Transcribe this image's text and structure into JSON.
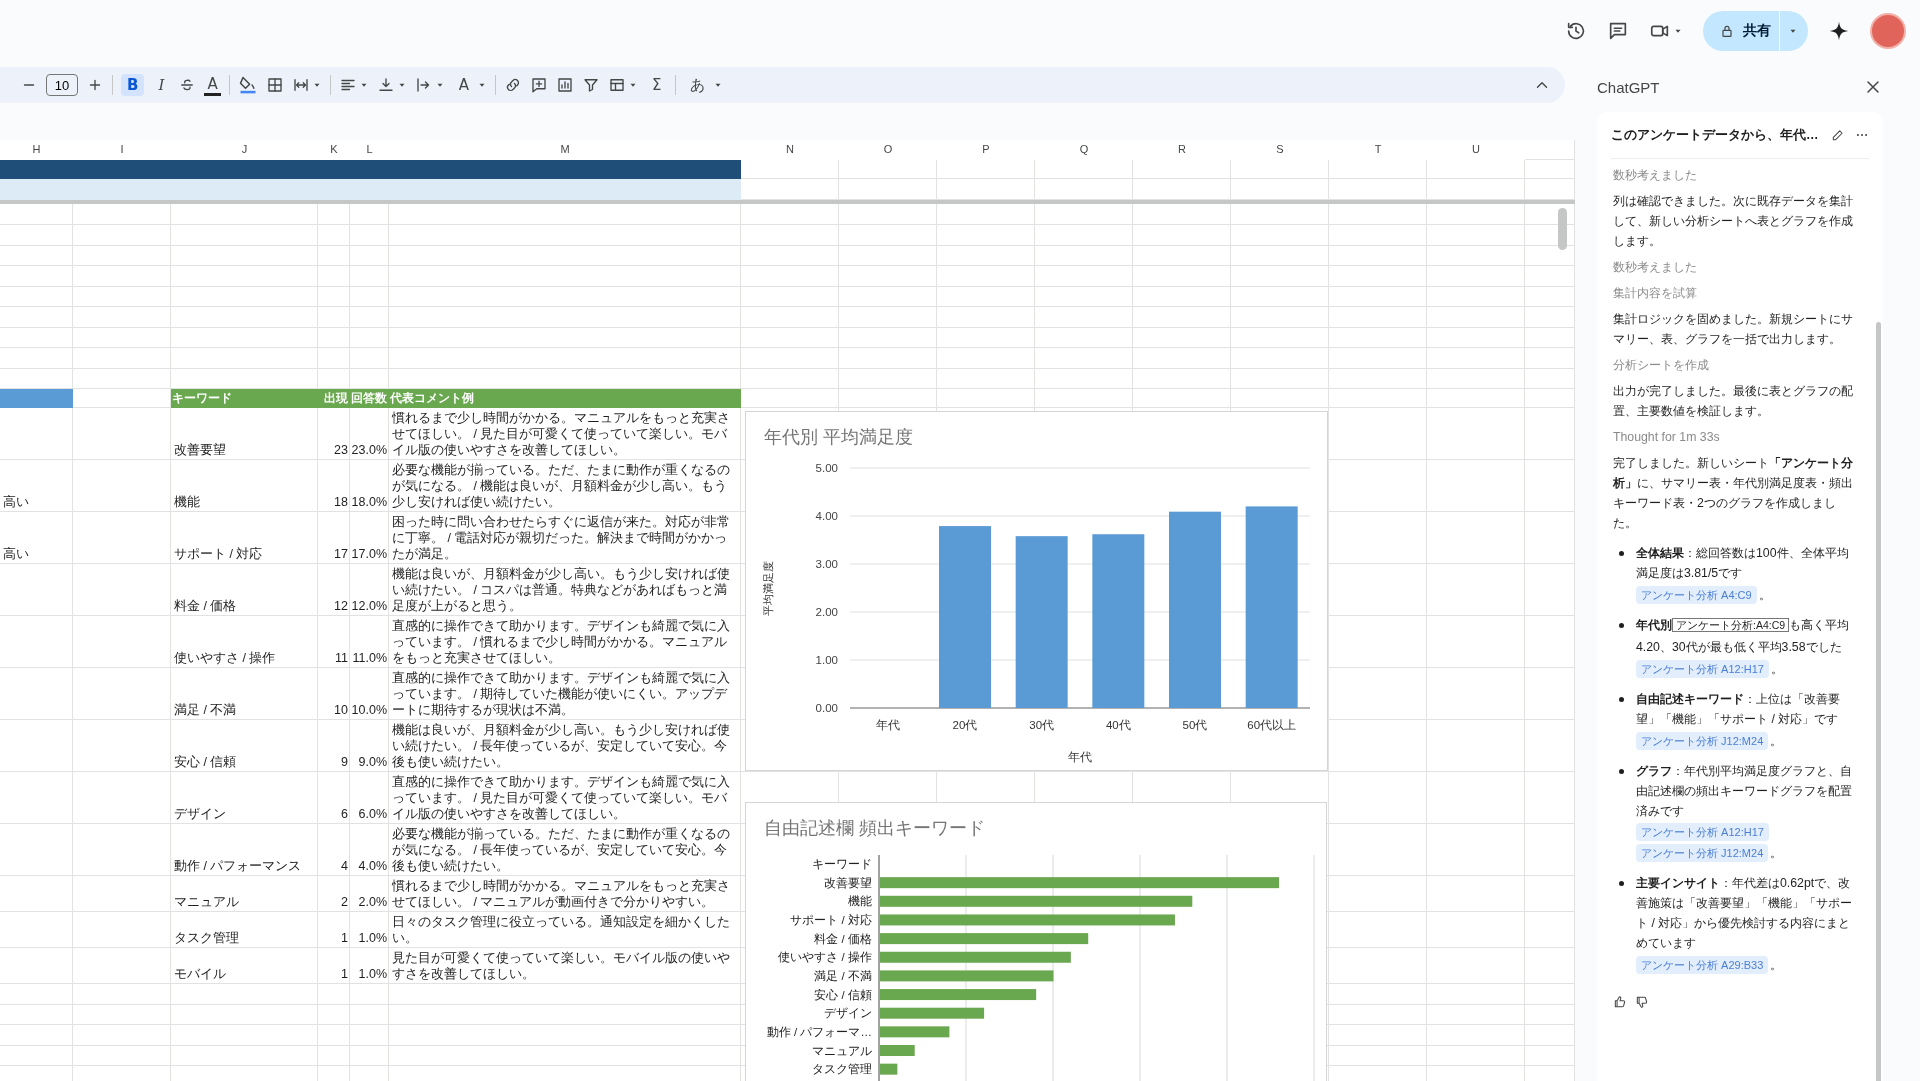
{
  "top_bar": {
    "share_button": {
      "label": "共有"
    }
  },
  "toolbar": {
    "font_size": "10",
    "bold": {
      "label": "B",
      "on": true
    },
    "italic": {
      "label": "I"
    },
    "text_color": {
      "label": "A"
    },
    "text_rotation": {
      "label": "A"
    },
    "functions": {
      "label": "Σ"
    },
    "input_tools": {
      "label": "あ"
    }
  },
  "sheet": {
    "column_headers": [
      "H",
      "I",
      "J",
      "K",
      "L",
      "M",
      "N",
      "O",
      "P",
      "Q",
      "R",
      "S",
      "T",
      "U"
    ],
    "keyword_table": {
      "headers": [
        "キーワード",
        "出現",
        "回答数",
        "代表コメント例"
      ],
      "rows": [
        {
          "keyword": "改善要望",
          "count": "23",
          "percent": "23.0%",
          "comment": "慣れるまで少し時間がかかる。マニュアルをもっと充実させてほしい。 / 見た目が可愛くて使っていて楽しい。モバイル版の使いやすさを改善してほしい。"
        },
        {
          "column_h": "高い",
          "keyword": "機能",
          "count": "18",
          "percent": "18.0%",
          "comment": "必要な機能が揃っている。ただ、たまに動作が重くなるのが気になる。 / 機能は良いが、月額料金が少し高い。もう少し安ければ使い続けたい。"
        },
        {
          "column_h": "高い",
          "keyword": "サポート / 対応",
          "count": "17",
          "percent": "17.0%",
          "comment": "困った時に問い合わせたらすぐに返信が来た。対応が非常に丁寧。 / 電話対応が親切だった。解決まで時間がかかったが満足。"
        },
        {
          "keyword": "料金 / 価格",
          "count": "12",
          "percent": "12.0%",
          "comment": "機能は良いが、月額料金が少し高い。もう少し安ければ使い続けたい。 / コスパは普通。特典などがあればもっと満足度が上がると思う。"
        },
        {
          "keyword": "使いやすさ / 操作",
          "count": "11",
          "percent": "11.0%",
          "comment": "直感的に操作できて助かります。デザインも綺麗で気に入っています。 / 慣れるまで少し時間がかかる。マニュアルをもっと充実させてほしい。"
        },
        {
          "keyword": "満足 / 不満",
          "count": "10",
          "percent": "10.0%",
          "comment": "直感的に操作できて助かります。デザインも綺麗で気に入っています。 / 期待していた機能が使いにくい。アップデートに期待するが現状は不満。"
        },
        {
          "keyword": "安心 / 信頼",
          "count": "9",
          "percent": "9.0%",
          "comment": "機能は良いが、月額料金が少し高い。もう少し安ければ使い続けたい。 / 長年使っているが、安定していて安心。今後も使い続けたい。"
        },
        {
          "keyword": "デザイン",
          "count": "6",
          "percent": "6.0%",
          "comment": "直感的に操作できて助かります。デザインも綺麗で気に入っています。 / 見た目が可愛くて使っていて楽しい。モバイル版の使いやすさを改善してほしい。"
        },
        {
          "keyword": "動作 / パフォーマンス",
          "count": "4",
          "percent": "4.0%",
          "comment": "必要な機能が揃っている。ただ、たまに動作が重くなるのが気になる。 / 長年使っているが、安定していて安心。今後も使い続けたい。"
        },
        {
          "keyword": "マニュアル",
          "count": "2",
          "percent": "2.0%",
          "comment": "慣れるまで少し時間がかかる。マニュアルをもっと充実させてほしい。 / マニュアルが動画付きで分かりやすい。"
        },
        {
          "keyword": "タスク管理",
          "count": "1",
          "percent": "1.0%",
          "comment": "日々のタスク管理に役立っている。通知設定を細かくしたい。"
        },
        {
          "keyword": "モバイル",
          "count": "1",
          "percent": "1.0%",
          "comment": "見た目が可愛くて使っていて楽しい。モバイル版の使いやすさを改善してほしい。"
        }
      ]
    }
  },
  "satisfaction_chart": {
    "chart_data": {
      "type": "bar",
      "title": "年代別 平均満足度",
      "xlabel": "年代",
      "ylabel": "平均満足度",
      "categories": [
        "年代",
        "20代",
        "30代",
        "40代",
        "50代",
        "60代以上"
      ],
      "series": [
        {
          "color": "#5b9bd5",
          "values": [
            null,
            3.79,
            3.58,
            3.62,
            4.09,
            4.2
          ]
        }
      ],
      "ylim": [
        0,
        5
      ],
      "grid": true,
      "yticks": [
        {
          "value": 0,
          "label": "0.00"
        },
        {
          "value": 1,
          "label": "1.00"
        },
        {
          "value": 2,
          "label": "2.00"
        },
        {
          "value": 3,
          "label": "3.00"
        },
        {
          "value": 4,
          "label": "4.00"
        },
        {
          "value": 5,
          "label": "5.00"
        }
      ]
    }
  },
  "keyword_chart": {
    "title": "自由記述欄 頻出キーワード",
    "categories": [
      "キーワード",
      "改善要望",
      "機能",
      "サポート / 対応",
      "料金 / 価格",
      "使いやすさ / 操作",
      "満足 / 不満",
      "安心 / 信頼",
      "デザイン",
      "動作 / パフォーマ…",
      "マニュアル",
      "タスク管理"
    ]
  },
  "chat_panel": {
    "title": "ChatGPT",
    "conversation_title": "このアンケートデータから、年代…",
    "messages": [
      {
        "kind": "status",
        "text": "数秒考えました"
      },
      {
        "kind": "text",
        "text": "列は確認できました。次に既存データを集計して、新しい分析シートへ表とグラフを作成します。"
      },
      {
        "kind": "status",
        "text": "数秒考えました"
      },
      {
        "kind": "status",
        "text": "集計内容を試算"
      },
      {
        "kind": "text",
        "text": "集計ロジックを固めました。新規シートにサマリー、表、グラフを一括で出力します。"
      },
      {
        "kind": "status",
        "text": "分析シートを作成"
      },
      {
        "kind": "text",
        "text": "出力が完了しました。最後に表とグラフの配置、主要数値を検証します。"
      },
      {
        "kind": "status",
        "text": "Thought for 1m 33s"
      },
      {
        "kind": "text",
        "text": "完了しました。新しいシート**「アンケート分析」**に、サマリー表・年代別満足度表・頻出キーワード表・2つのグラフを作成しました。"
      },
      {
        "kind": "bullets",
        "items": [
          {
            "kind": "plain",
            "text": "**全体結果**：総回答数は100件、全体平均満足度は3.81/5です",
            "refs": [
              "アンケート分析 A4:C9"
            ],
            "end": "。"
          },
          {
            "kind": "tooltip",
            "lead": "年代別",
            "tooltip": "アンケート分析:A4:C9",
            "text": "も高く平均",
            "text_2": "4.20、30代が最も低く平均3.58でした",
            "refs": [
              "アンケート分析 A12:H17"
            ],
            "end": "。"
          },
          {
            "kind": "plain",
            "text": "**自由記述キーワード**：上位は「改善要望」「機能」「サポート / 対応」です",
            "refs": [
              "アンケート分析 J12:M24"
            ],
            "end": "。"
          },
          {
            "kind": "plain",
            "text": "**グラフ**：年代別平均満足度グラフと、自由記述欄の頻出キーワードグラフを配置済みです",
            "refs": [
              "アンケート分析 A12:H17",
              "アンケート分析 J12:M24"
            ],
            "end": "。"
          },
          {
            "kind": "plain",
            "text": "**主要インサイト**：年代差は0.62ptで、改善施策は「改善要望」「機能」「サポート / 対応」から優先検討する内容にまとめています",
            "refs": [
              "アンケート分析 A29:B33"
            ],
            "end": "。"
          }
        ]
      }
    ]
  }
}
